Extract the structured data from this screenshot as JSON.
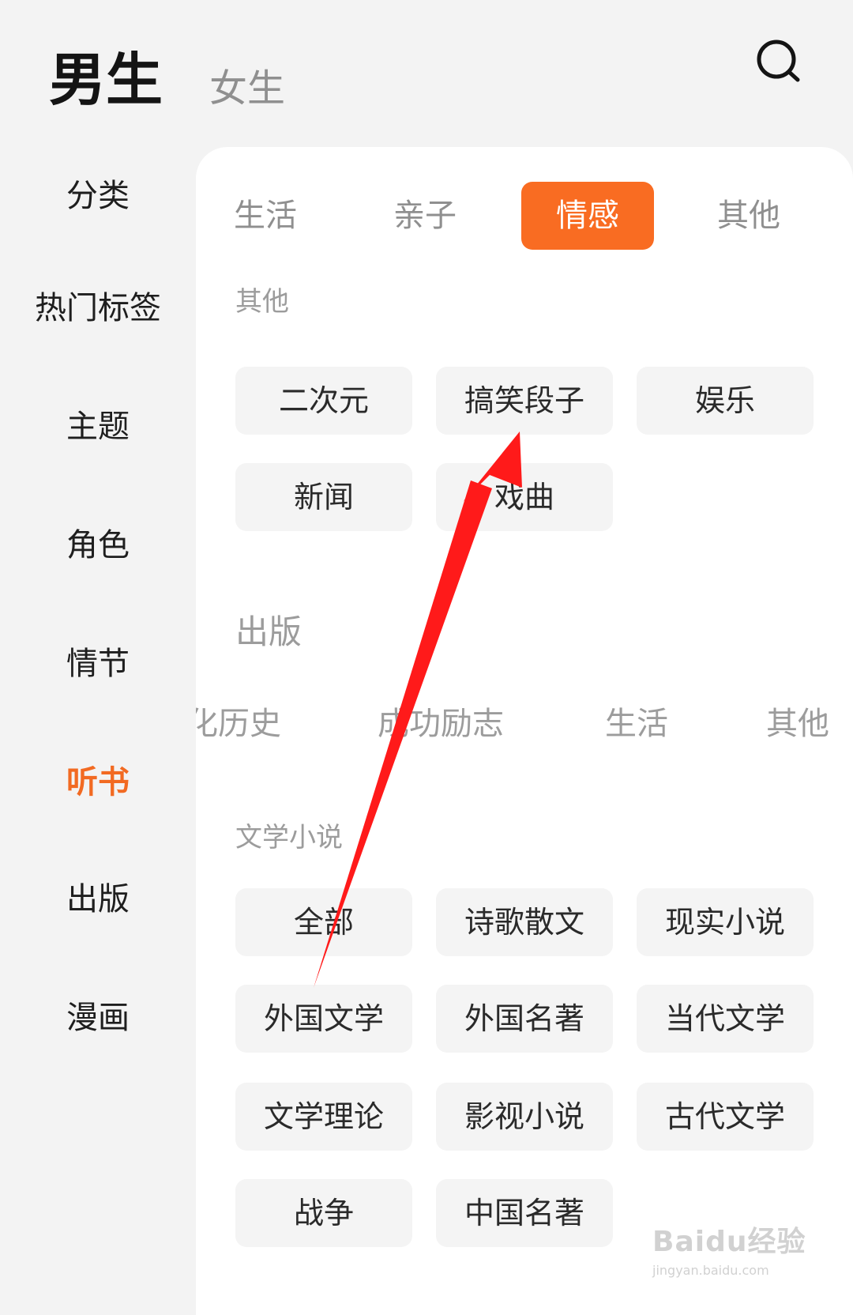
{
  "header": {
    "tab_male": "男生",
    "tab_female": "女生",
    "search_icon": "search-icon"
  },
  "sidebar": {
    "items": [
      {
        "label": "分类"
      },
      {
        "label": "热门标签"
      },
      {
        "label": "主题"
      },
      {
        "label": "角色"
      },
      {
        "label": "情节"
      },
      {
        "label": "听书",
        "active": true
      },
      {
        "label": "出版"
      },
      {
        "label": "漫画"
      }
    ]
  },
  "category_tabs": [
    {
      "label": "生活"
    },
    {
      "label": "亲子"
    },
    {
      "label": "情感",
      "active": true
    },
    {
      "label": "其他"
    }
  ],
  "section_other": {
    "title": "其他",
    "chips": [
      "二次元",
      "搞笑段子",
      "娱乐",
      "新闻",
      "戏曲"
    ]
  },
  "section_publish": {
    "title": "出版",
    "items": [
      "化历史",
      "成功励志",
      "生活",
      "其他"
    ]
  },
  "section_literature": {
    "title": "文学小说",
    "chips": [
      "全部",
      "诗歌散文",
      "现实小说",
      "外国文学",
      "外国名著",
      "当代文学",
      "文学理论",
      "影视小说",
      "古代文学",
      "战争",
      "中国名著"
    ]
  },
  "watermark": {
    "logo": "Baidu经验",
    "url": "jingyan.baidu.com"
  },
  "colors": {
    "accent": "#f96c22",
    "sidebar_active": "#f26a22",
    "arrow": "#ff1a1a",
    "background": "#f3f3f3",
    "panel": "#ffffff",
    "chip": "#f4f4f4"
  }
}
